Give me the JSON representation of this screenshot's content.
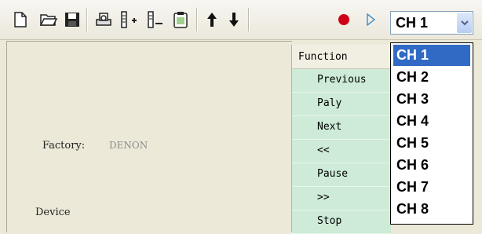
{
  "toolbar": {
    "icons": [
      "new-file-icon",
      "open-folder-icon",
      "save-icon",
      "print-preview-icon",
      "add-device-icon",
      "remove-device-icon",
      "clipboard-icon",
      "move-up-icon",
      "move-down-icon",
      "record-icon",
      "play-icon"
    ]
  },
  "channel_select": {
    "value": "CH 1",
    "options": [
      "CH 1",
      "CH 2",
      "CH 3",
      "CH 4",
      "CH 5",
      "CH 6",
      "CH 7",
      "CH 8"
    ],
    "selected_index": 0
  },
  "left_panel": {
    "factory_label": "Factory:",
    "factory_value": "DENON",
    "device_label": "Device"
  },
  "function_list": {
    "header": "Function",
    "items": [
      "Previous",
      "Paly",
      "Next",
      "<<",
      "Pause",
      ">>",
      "Stop"
    ]
  },
  "colors": {
    "selected_item": "#316ac5",
    "row_background": "#cdebd6",
    "record": "#d00018"
  }
}
